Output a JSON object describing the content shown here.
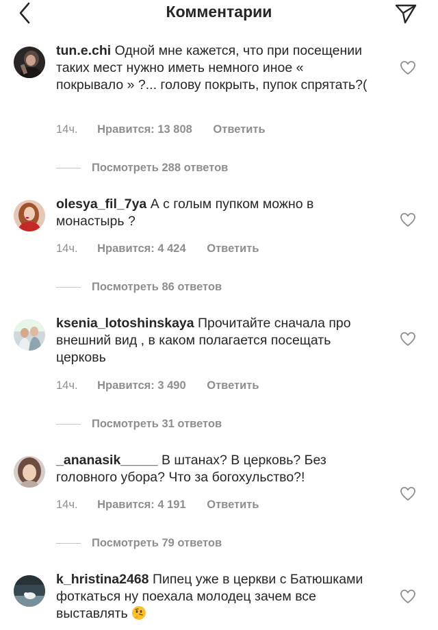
{
  "header": {
    "title": "Комментарии",
    "back_icon": "chevron-left-icon",
    "send_icon": "direct-send-icon"
  },
  "comments": [
    {
      "username": "tun.e.chi",
      "text": "Одной мне кажется, что при посещении таких мест нужно иметь немного иное « покрывало » ?... голову покрыть, пупок спрятать?(",
      "time": "14ч.",
      "likes": "Нравится: 13 808",
      "reply": "Ответить",
      "view_replies": "Посмотреть 288 ответов"
    },
    {
      "username": "olesya_fil_7ya",
      "text": "А с голым пупком можно в монастырь ?",
      "time": "14ч.",
      "likes": "Нравится: 4 424",
      "reply": "Ответить",
      "view_replies": "Посмотреть 86 ответов"
    },
    {
      "username": "ksenia_lotoshinskaya",
      "text": "Прочитайте сначала про внешний вид , в каком полагается посещать церковь",
      "time": "14ч.",
      "likes": "Нравится: 3 490",
      "reply": "Ответить",
      "view_replies": "Посмотреть 31 ответов"
    },
    {
      "username": "_ananasik_____",
      "text": "В штанах? В церковь? Без головного убора? Что за богохульство?!",
      "time": "14ч.",
      "likes": "Нравится: 4 191",
      "reply": "Ответить",
      "view_replies": "Посмотреть 79 ответов"
    },
    {
      "username": "k_hristina2468",
      "text": "Пипец уже в церкви с Батюшками фоткаться ну поехала молодец зачем все выставлять",
      "emoji": "thinking-face-emoji"
    }
  ],
  "colors": {
    "text": "#262626",
    "secondary": "#8e8e8e",
    "background": "#ffffff"
  }
}
